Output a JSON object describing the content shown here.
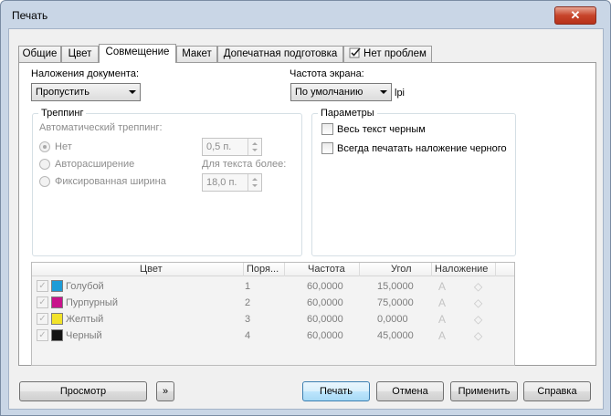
{
  "window": {
    "title": "Печать",
    "close_glyph": "✕"
  },
  "tabs": [
    {
      "label": "Общие"
    },
    {
      "label": "Цвет"
    },
    {
      "label": "Совмещение"
    },
    {
      "label": "Макет"
    },
    {
      "label": "Допечатная подготовка"
    },
    {
      "label": "Нет проблем",
      "icon": "checklist-icon"
    }
  ],
  "doc_overprints": {
    "label": "Наложения документа:",
    "value": "Пропустить"
  },
  "screen_freq": {
    "label": "Частота экрана:",
    "value": "По умолчанию",
    "unit": "lpi"
  },
  "trapping": {
    "title": "Треппинг",
    "auto_label": "Автоматический треппинг:",
    "options": [
      {
        "label": "Нет",
        "selected": true
      },
      {
        "label": "Авторасширение",
        "selected": false
      },
      {
        "label": "Фиксированная ширина",
        "selected": false
      }
    ],
    "width_value": "0,5 п.",
    "text_above_label": "Для текста более:",
    "text_above_value": "18,0 п."
  },
  "params": {
    "title": "Параметры",
    "all_text_black": "Весь текст черным",
    "always_overprint_black": "Всегда печатать наложение черного"
  },
  "table": {
    "headers": {
      "color": "Цвет",
      "order": "Поря...",
      "frequency": "Частота",
      "angle": "Угол",
      "overprint": "Наложение"
    },
    "rows": [
      {
        "name": "Голубой",
        "order": "1",
        "frequency": "60,0000",
        "angle": "15,0000",
        "swatch": "#1e9cd7"
      },
      {
        "name": "Пурпурный",
        "order": "2",
        "frequency": "60,0000",
        "angle": "75,0000",
        "swatch": "#c8138b"
      },
      {
        "name": "Желтый",
        "order": "3",
        "frequency": "60,0000",
        "angle": "0,0000",
        "swatch": "#f2e32a"
      },
      {
        "name": "Черный",
        "order": "4",
        "frequency": "60,0000",
        "angle": "45,0000",
        "swatch": "#141414"
      }
    ],
    "check_glyph": "✓",
    "overprint_text_glyph": "A",
    "overprint_fill_glyph": "◇"
  },
  "buttons": {
    "preview": "Просмотр",
    "expand_glyph": "»",
    "print": "Печать",
    "cancel": "Отмена",
    "apply": "Применить",
    "help": "Справка"
  }
}
